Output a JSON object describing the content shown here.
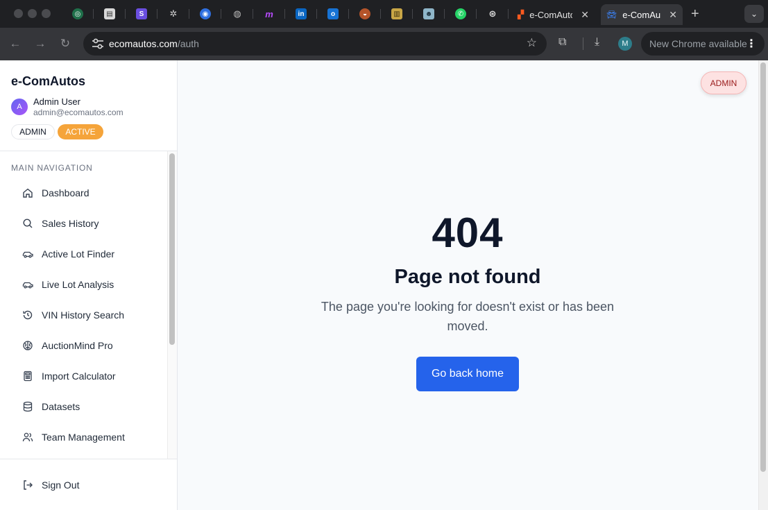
{
  "browser": {
    "tabs": [
      {
        "label": "e-ComAutos",
        "active": false
      },
      {
        "label": "e-ComAutos",
        "active": true
      }
    ],
    "url_host": "ecomautos.com",
    "url_path": "/auth",
    "profile_initial": "M",
    "update_label": "New Chrome available"
  },
  "sidebar": {
    "brand": "e-ComAutos",
    "user": {
      "initial": "A",
      "name": "Admin User",
      "email": "admin@ecomautos.com",
      "role": "ADMIN",
      "status": "ACTIVE"
    },
    "section_heading": "MAIN NAVIGATION",
    "items": [
      {
        "label": "Dashboard",
        "icon": "home-icon"
      },
      {
        "label": "Sales History",
        "icon": "search-icon"
      },
      {
        "label": "Active Lot Finder",
        "icon": "car-icon"
      },
      {
        "label": "Live Lot Analysis",
        "icon": "car-icon"
      },
      {
        "label": "VIN History Search",
        "icon": "history-icon"
      },
      {
        "label": "AuctionMind Pro",
        "icon": "brain-icon"
      },
      {
        "label": "Import Calculator",
        "icon": "calculator-icon"
      },
      {
        "label": "Datasets",
        "icon": "database-icon"
      },
      {
        "label": "Team Management",
        "icon": "users-icon"
      }
    ],
    "sign_out": "Sign Out"
  },
  "header": {
    "role_badge": "ADMIN"
  },
  "not_found": {
    "code": "404",
    "title": "Page not found",
    "description": "The page you're looking for doesn't exist or has been moved.",
    "button": "Go back home"
  },
  "colors": {
    "primary": "#2563eb",
    "status_badge": "#f5a43a",
    "admin_pill_bg": "#fde2e2",
    "heading": "#0f172a"
  }
}
